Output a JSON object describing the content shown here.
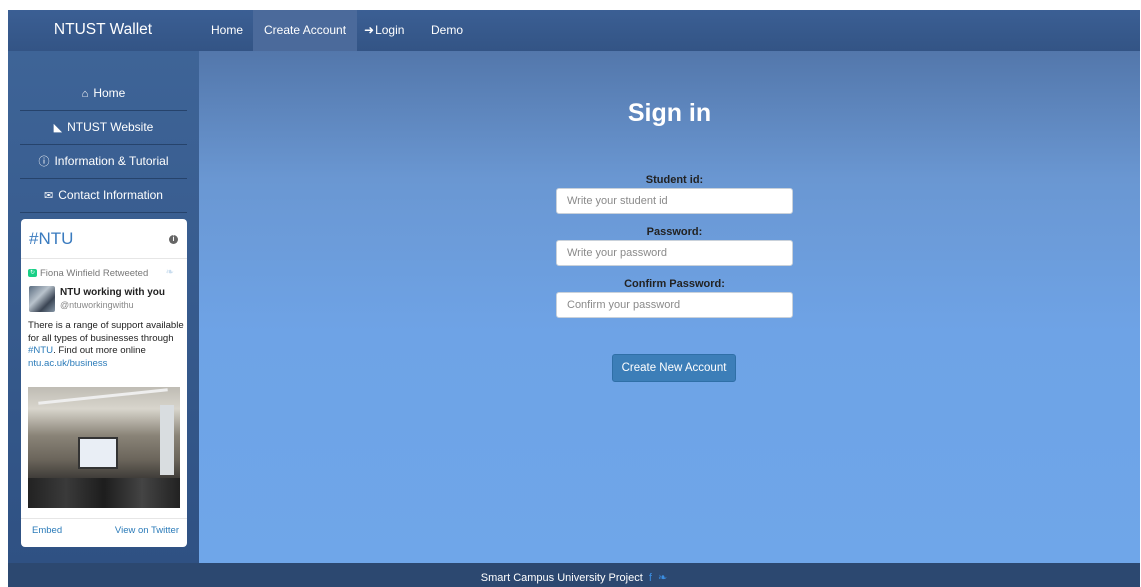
{
  "nav": {
    "brand": "NTUST Wallet",
    "items": [
      {
        "label": "Home"
      },
      {
        "label": "Create Account"
      },
      {
        "label": "Login"
      },
      {
        "label": "Demo"
      }
    ]
  },
  "sidebar": {
    "items": [
      {
        "label": "Home",
        "icon": "home-icon"
      },
      {
        "label": "NTUST Website",
        "icon": "graduation-cap-icon"
      },
      {
        "label": "Information & Tutorial",
        "icon": "info-icon"
      },
      {
        "label": "Contact Information",
        "icon": "envelope-icon"
      }
    ]
  },
  "widget": {
    "hashtag": "#NTU",
    "retweet_by": "Fiona Winfield Retweeted",
    "author_name": "NTU working with you",
    "author_handle": "@ntuworkingwithu",
    "text_1": "There is a range of support available for all types of businesses through ",
    "hashtag_link": "#NTU",
    "text_2": ". Find out more online ",
    "url_link": "ntu.ac.uk/business",
    "embed": "Embed",
    "view_on_twitter": "View on Twitter"
  },
  "form": {
    "title": "Sign in",
    "student_id_label": "Student id:",
    "student_id_placeholder": "Write your student id",
    "password_label": "Password:",
    "password_placeholder": "Write your password",
    "confirm_label": "Confirm Password:",
    "confirm_placeholder": "Confirm your password",
    "submit": "Create New Account"
  },
  "footer": {
    "text": "Smart Campus University Project"
  },
  "colors": {
    "nav_bg": "#3b5f94",
    "main_bg": "#6fa6e9",
    "button": "#3c7eb8",
    "link": "#2b7bb9"
  }
}
